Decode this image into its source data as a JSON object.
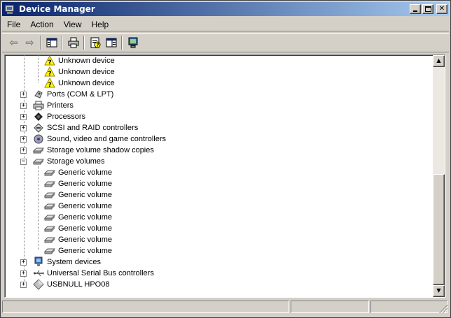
{
  "window": {
    "title": "Device Manager"
  },
  "menu": [
    "File",
    "Action",
    "View",
    "Help"
  ],
  "toolbar": {
    "buttons": [
      "back-icon",
      "forward-icon",
      "show-hide-tree-icon",
      "print-icon",
      "properties-icon",
      "help-icon",
      "scan-hardware-icon"
    ]
  },
  "tree": {
    "unknown_devices": [
      "Unknown device",
      "Unknown device",
      "Unknown device"
    ],
    "categories_before": [
      {
        "label": "Ports (COM & LPT)",
        "icon": "port-icon"
      },
      {
        "label": "Printers",
        "icon": "printer-icon"
      },
      {
        "label": "Processors",
        "icon": "processor-icon"
      },
      {
        "label": "SCSI and RAID controllers",
        "icon": "scsi-icon"
      },
      {
        "label": "Sound, video and game controllers",
        "icon": "sound-icon"
      },
      {
        "label": "Storage volume shadow copies",
        "icon": "disk-icon"
      }
    ],
    "expanded_category": {
      "label": "Storage volumes",
      "icon": "disk-icon"
    },
    "volumes": [
      "Generic volume",
      "Generic volume",
      "Generic volume",
      "Generic volume",
      "Generic volume",
      "Generic volume",
      "Generic volume",
      "Generic volume"
    ],
    "categories_after": [
      {
        "label": "System devices",
        "icon": "system-icon"
      },
      {
        "label": "Universal Serial Bus controllers",
        "icon": "usb-icon"
      },
      {
        "label": "USBNULL HPO08",
        "icon": "diamond-icon"
      }
    ]
  },
  "colors": {
    "title_start": "#0a246a",
    "title_end": "#a6caf0",
    "face": "#d4d0c8"
  }
}
